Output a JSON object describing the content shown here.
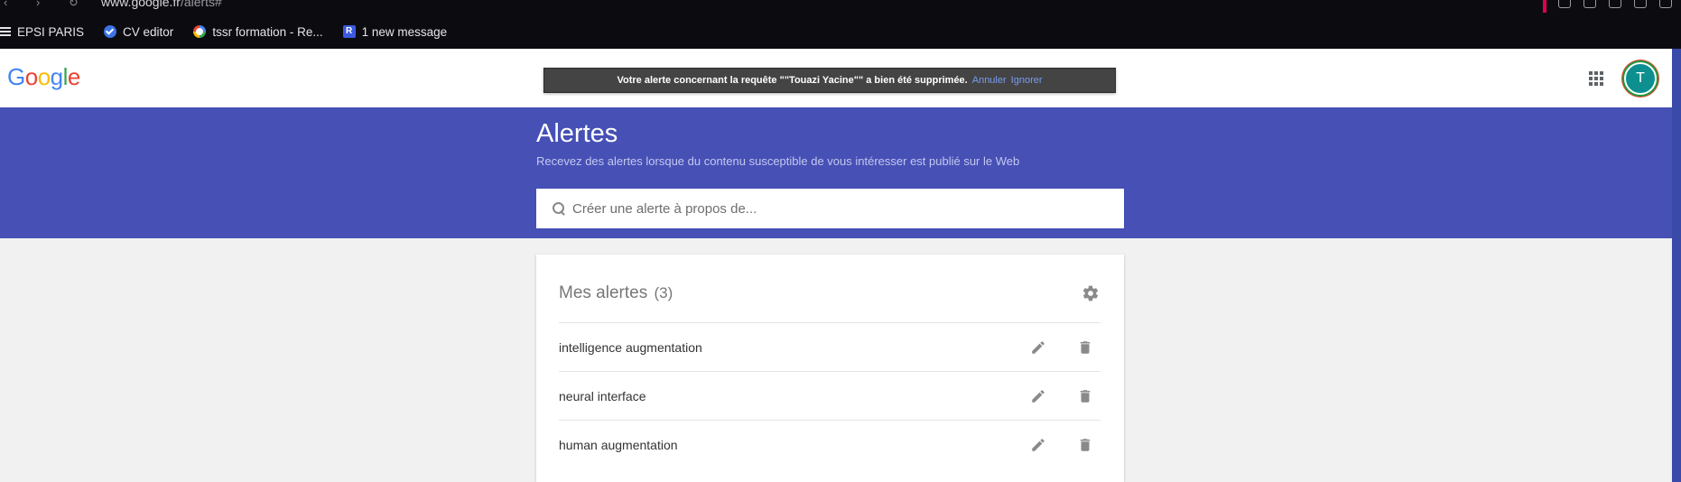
{
  "browser": {
    "url_domain": "www.google.fr",
    "url_path": "/alerts#",
    "bookmarks": [
      {
        "label": "EPSI PARIS",
        "icon": "list-icon"
      },
      {
        "label": "CV editor",
        "icon": "check-circle-icon"
      },
      {
        "label": "tssr formation - Re...",
        "icon": "google-icon"
      },
      {
        "label": "1 new message",
        "icon": "r-app-icon"
      }
    ],
    "accent_color": "#e0004d"
  },
  "header": {
    "logo_letters": [
      "G",
      "o",
      "o",
      "g",
      "l",
      "e"
    ],
    "toast": {
      "message": "Votre alerte concernant la requête \"\"Touazi Yacine\"\" a bien été supprimée.",
      "undo_label": "Annuler",
      "dismiss_label": "Ignorer"
    },
    "avatar_initial": "T"
  },
  "banner": {
    "title": "Alertes",
    "subtitle": "Recevez des alertes lorsque du contenu susceptible de vous intéresser est publié sur le Web",
    "search_placeholder": "Créer une alerte à propos de...",
    "color": "#4650b5"
  },
  "alerts": {
    "title": "Mes alertes",
    "count": "(3)",
    "items": [
      {
        "label": "intelligence augmentation"
      },
      {
        "label": "neural interface"
      },
      {
        "label": "human augmentation"
      }
    ]
  }
}
